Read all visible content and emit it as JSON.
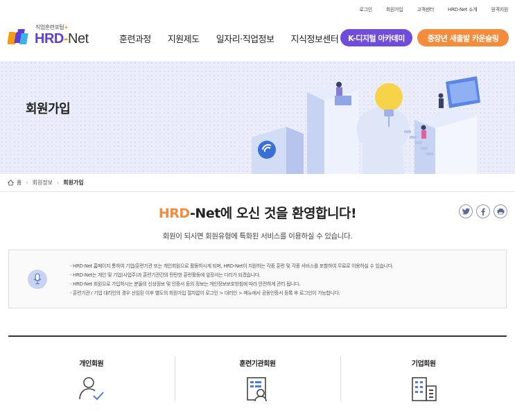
{
  "util_links": [
    "로그인",
    "회원가입",
    "고객센터",
    "HRD-Net 소개",
    "원격지원"
  ],
  "logo": {
    "sub": "직업훈련포털",
    "sub_plus": "+",
    "hrd": "HRD",
    "dash": "-",
    "net": "Net"
  },
  "gnb": [
    "훈련과정",
    "지원제도",
    "일자리·직업정보",
    "지식정보센터"
  ],
  "buttons": {
    "kdigital": "K-디지털 아카데미",
    "career": "중장년 새출발 카운슬링"
  },
  "banner": {
    "title": "회원가입"
  },
  "breadcrumb": {
    "home": "홈",
    "level1": "회원정보",
    "current": "회원가입"
  },
  "welcome": {
    "brand_hrd": "HRD",
    "brand_rest": "-Net",
    "text": "에 오신 것을 환영합니다!"
  },
  "sub_welcome": "회원이 되시면 회원유형에 특화된 서비스를 이용하실 수 있습니다.",
  "info": [
    "- HRD-Net 홈페이지 통하여 기업/훈련기관 또는 개인회원으로 활동하시게 되며, HRD-Net이 지원하는 각종 훈련 및 각종 서비스를 포함하여 무료로 이용하실 수 있습니다.",
    "- HRD-Net는 개인 및 기업(사업주)과 훈련기관간의 탄탄한 훈련활동에 앞장서는 다리가 되겠습니다.",
    "- HRD-Net 회원으로 가입하시는 분들의 신상정보 및 인증서 등의 정보는 개인정보보호방침에 따라 안전하게 관리 됩니다.",
    "- 훈련기관 / 기업 대리인의 경우 선임된 이후 별도의 회원가입 절차없이 로그인 > 대리인 > 메뉴에서 공동인증서 등록 후 로그인이 가능합니다."
  ],
  "members": [
    {
      "label": "개인회원",
      "icon": "person-check-icon"
    },
    {
      "label": "훈련기관회원",
      "icon": "institution-icon"
    },
    {
      "label": "기업회원",
      "icon": "building-icon"
    }
  ],
  "colors": {
    "brand_purple": "#6f4cdb",
    "brand_orange": "#f58b3c",
    "banner_bg": "#ebeefa",
    "icon_blue": "#4a7be0"
  }
}
